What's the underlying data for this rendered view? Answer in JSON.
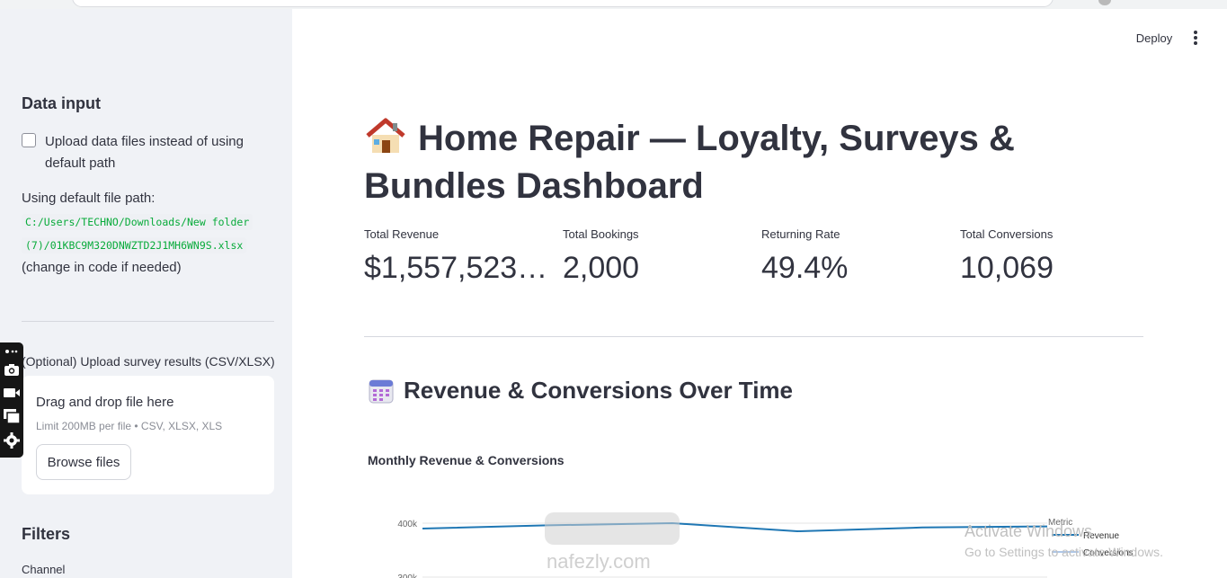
{
  "sidebar": {
    "data_input_heading": "Data input",
    "upload_checkbox_label": "Upload data files instead of using default path",
    "default_path_label": "Using default file path:",
    "path_line1": "C:/Users/TECHNO/Downloads/New folder",
    "path_line2": "(7)/01KBC9M320DNWZTD2J1MH6WN9S.xlsx",
    "path_note": "(change in code if needed)",
    "survey_label": "(Optional) Upload survey results (CSV/XLSX)",
    "uploader": {
      "title": "Drag and drop file here",
      "limit": "Limit 200MB per file • CSV, XLSX, XLS",
      "browse_label": "Browse files"
    },
    "filters_heading": "Filters",
    "channel_label": "Channel"
  },
  "toolbar": {
    "deploy_label": "Deploy"
  },
  "main": {
    "title": "Home Repair — Loyalty, Surveys & Bundles Dashboard",
    "metrics": [
      {
        "label": "Total Revenue",
        "value": "$1,557,523.…"
      },
      {
        "label": "Total Bookings",
        "value": "2,000"
      },
      {
        "label": "Returning Rate",
        "value": "49.4%"
      },
      {
        "label": "Total Conversions",
        "value": "10,069"
      }
    ],
    "section_title": "Revenue & Conversions Over Time"
  },
  "chart_data": {
    "type": "line",
    "title": "Monthly Revenue & Conversions",
    "y_ticks": [
      "400k",
      "300k"
    ],
    "legend_title": "Metric",
    "series": [
      {
        "name": "Revenue",
        "values": [
          390000,
          396000,
          400000,
          385000,
          392000,
          394000
        ],
        "color": "#1f77b4"
      },
      {
        "name": "Conversions",
        "values": [],
        "color": "#aec7e8"
      }
    ],
    "legend_placement": "right"
  },
  "overlay": {
    "activate_title": "Activate Windows",
    "activate_sub": "Go to Settings to activate Windows.",
    "watermark_domain": "nafezly.com"
  }
}
